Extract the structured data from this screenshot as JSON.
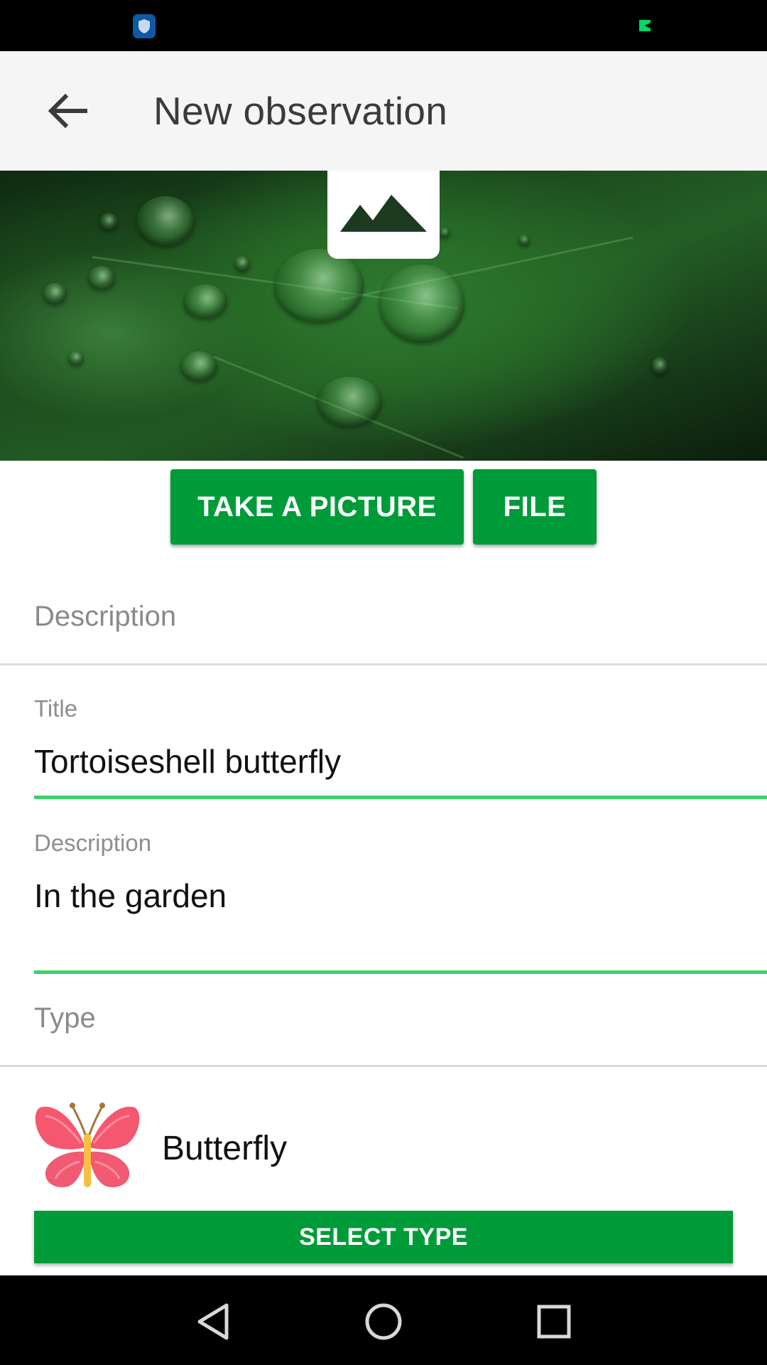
{
  "status_bar": {
    "icons": [
      "shield-icon",
      "green-notification-icon"
    ],
    "colors": {
      "shield": "#0c5aa6",
      "notification": "#00d46a"
    }
  },
  "app_bar": {
    "back_icon": "arrow-left-icon",
    "title": "New observation"
  },
  "image": {
    "placeholder_icon": "image-mountains-icon"
  },
  "buttons": {
    "take_picture": "TAKE A PICTURE",
    "file": "FILE"
  },
  "description_section": {
    "header": "Description"
  },
  "fields": {
    "title_label": "Title",
    "title_value": "Tortoiseshell butterfly",
    "description_label": "Description",
    "description_value": "In the garden"
  },
  "type_section": {
    "header": "Type",
    "selected_type": "Butterfly",
    "selected_icon": "butterfly-icon",
    "select_button": "SELECT TYPE"
  },
  "nav_bar": {
    "icons": [
      "nav-back-icon",
      "nav-home-icon",
      "nav-recents-icon"
    ]
  },
  "colors": {
    "accent": "#009b39",
    "field_underline": "#3dd169",
    "app_bar_bg": "#f5f5f5"
  }
}
